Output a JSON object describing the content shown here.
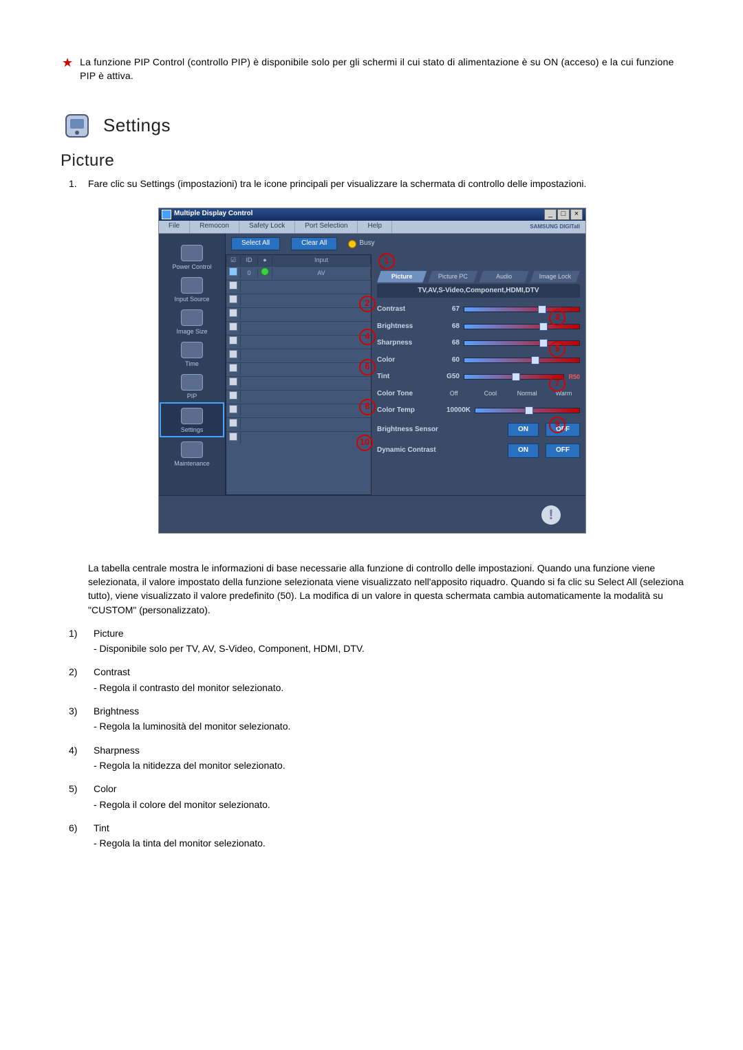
{
  "note": "La funzione PIP Control (controllo PIP) è disponibile solo per gli schermi il cui stato di alimentazione è su ON (acceso) e la cui funzione PIP è attiva.",
  "heading": "Settings",
  "subheading": "Picture",
  "intro_num": "1.",
  "intro_text": "Fare clic su Settings (impostazioni) tra le icone principali per visualizzare la schermata di controllo delle impostazioni.",
  "window": {
    "title": "Multiple Display Control",
    "menu": [
      "File",
      "Remocon",
      "Safety Lock",
      "Port Selection",
      "Help"
    ],
    "brand": "SAMSUNG DIGITall",
    "win_btns": [
      "_",
      "□",
      "×"
    ],
    "sidebar": [
      {
        "label": "Power Control",
        "active": false
      },
      {
        "label": "Input Source",
        "active": false
      },
      {
        "label": "Image Size",
        "active": false
      },
      {
        "label": "Time",
        "active": false
      },
      {
        "label": "PIP",
        "active": false
      },
      {
        "label": "Settings",
        "active": true
      },
      {
        "label": "Maintenance",
        "active": false
      }
    ],
    "buttons": {
      "select_all": "Select All",
      "clear_all": "Clear All",
      "busy": "Busy"
    },
    "list_headers": {
      "check": "☑",
      "id": "ID",
      "status": "●",
      "input": "Input"
    },
    "list_rows_count": 13,
    "first_row": {
      "checked": true,
      "id": "0",
      "status_on": true,
      "input": "AV"
    },
    "tabs": [
      "Picture",
      "Picture PC",
      "Audio",
      "Image Lock"
    ],
    "active_tab": "Picture",
    "subtitle": "TV,AV,S-Video,Component,HDMI,DTV",
    "controls": [
      {
        "label": "Contrast",
        "value": "67"
      },
      {
        "label": "Brightness",
        "value": "68"
      },
      {
        "label": "Sharpness",
        "value": "68"
      },
      {
        "label": "Color",
        "value": "60"
      },
      {
        "label": "Tint",
        "value": "G50",
        "right": "R50"
      }
    ],
    "color_tone": {
      "label": "Color Tone",
      "options": [
        "Off",
        "Cool",
        "Normal",
        "Warm"
      ]
    },
    "color_temp": {
      "label": "Color Temp",
      "value": "10000K"
    },
    "brightness_sensor": {
      "label": "Brightness Sensor",
      "on": "ON",
      "off": "OFF"
    },
    "dynamic_contrast": {
      "label": "Dynamic Contrast",
      "on": "ON",
      "off": "OFF"
    }
  },
  "callouts": [
    "1",
    "2",
    "3",
    "4",
    "5",
    "6",
    "7",
    "8",
    "9",
    "10"
  ],
  "desc_para": "La tabella centrale mostra le informazioni di base necessarie alla funzione di controllo delle impostazioni. Quando una funzione viene selezionata, il valore impostato della funzione selezionata viene visualizzato nell'apposito riquadro. Quando si fa clic su Select All (seleziona tutto), viene visualizzato il valore predefinito (50). La modifica di un valore in questa schermata cambia automaticamente la modalità su \"CUSTOM\" (personalizzato).",
  "legend": [
    {
      "idx": "1)",
      "title": "Picture",
      "sub": "- Disponibile solo per TV, AV, S-Video, Component, HDMI, DTV."
    },
    {
      "idx": "2)",
      "title": "Contrast",
      "sub": "- Regola il contrasto del monitor selezionato."
    },
    {
      "idx": "3)",
      "title": "Brightness",
      "sub": "- Regola la luminosità del monitor selezionato."
    },
    {
      "idx": "4)",
      "title": "Sharpness",
      "sub": "- Regola la nitidezza del monitor selezionato."
    },
    {
      "idx": "5)",
      "title": "Color",
      "sub": "- Regola il colore del monitor selezionato."
    },
    {
      "idx": "6)",
      "title": "Tint",
      "sub": "- Regola la tinta del monitor selezionato."
    }
  ]
}
